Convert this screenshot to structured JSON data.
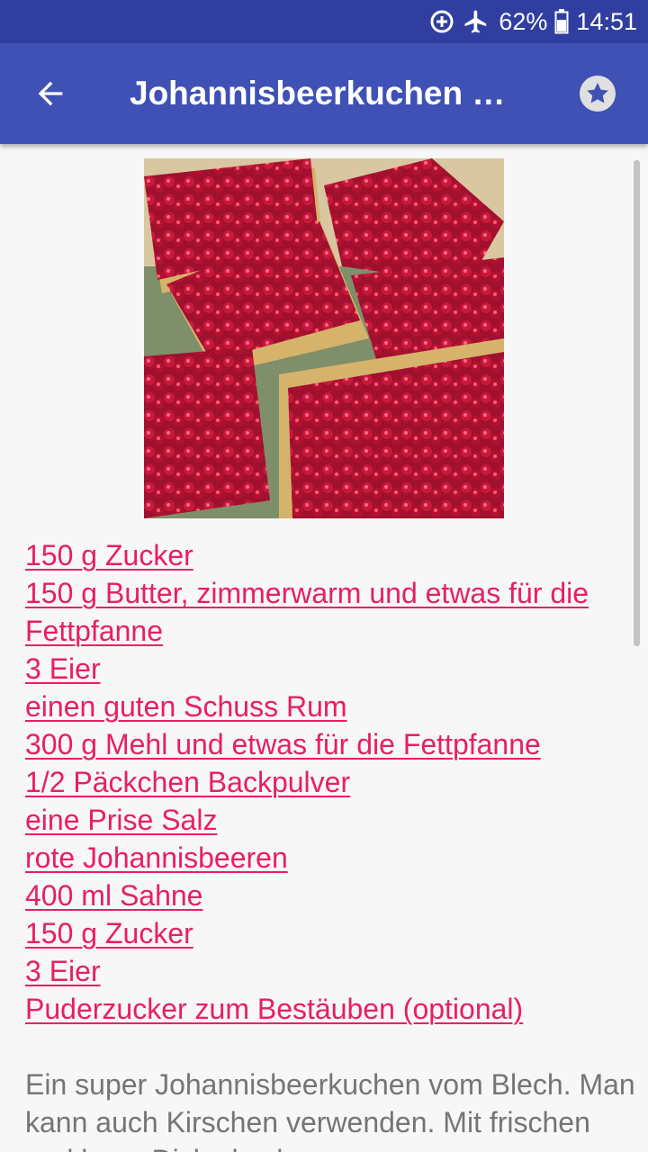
{
  "status_bar": {
    "battery": "62%",
    "time": "14:51",
    "icons": [
      "data-saver-icon",
      "airplane-icon",
      "battery-icon"
    ]
  },
  "app_bar": {
    "title": "Johannisbeerkuchen m…",
    "back_icon": "arrow-back-icon",
    "favorite_icon": "star-icon"
  },
  "ingredients": [
    "150 g Zucker",
    "150 g Butter, zimmerwarm und etwas für die Fettpfanne",
    "3 Eier",
    "einen guten Schuss Rum",
    "300 g Mehl und etwas für die Fettpfanne",
    "1/2 Päckchen Backpulver",
    "eine Prise Salz",
    "rote Johannisbeeren",
    "400 ml Sahne",
    "150 g Zucker",
    "3 Eier",
    "Puderzucker zum Bestäuben (optional)"
  ],
  "description": "Ein super Johannisbeerkuchen vom Blech. Man kann auch Kirschen verwenden. Mit frischen und kann Dicke kuchen so ...",
  "colors": {
    "status_bar": "#303f9f",
    "app_bar": "#3f51b5",
    "link": "#e91e63",
    "text_secondary": "#757575"
  }
}
